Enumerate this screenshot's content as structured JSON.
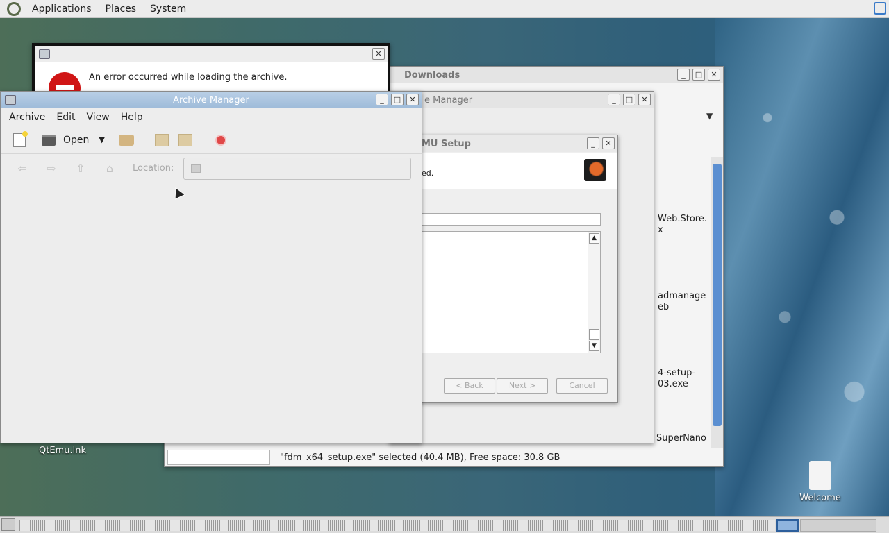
{
  "top_panel": {
    "menus": [
      "Applications",
      "Places",
      "System"
    ]
  },
  "desktop": {
    "icons": [
      {
        "label": "QtEmu.lnk"
      },
      {
        "label": "Welcome"
      }
    ]
  },
  "error_dialog": {
    "message": "An error occurred while loading the archive."
  },
  "downloads_window": {
    "title": "Downloads",
    "files": [
      {
        "line1": "Web.Store.",
        "line2": "x"
      },
      {
        "line1": "admanage",
        "line2": "eb"
      },
      {
        "line1": "4-setup-",
        "line2": "03.exe"
      },
      {
        "line1": "SuperNano",
        "line2": ""
      }
    ],
    "status": "\"fdm_x64_setup.exe\" selected (40.4 MB), Free space: 30.8 GB"
  },
  "archive_manager_back": {
    "title": "e Manager"
  },
  "setup_dialog": {
    "title": "MU Setup",
    "header_text": "ed.",
    "buttons": {
      "back": "< Back",
      "next": "Next >",
      "cancel": "Cancel"
    }
  },
  "archive_manager": {
    "title": "Archive Manager",
    "menu": {
      "archive": "Archive",
      "edit": "Edit",
      "view": "View",
      "help": "Help"
    },
    "toolbar": {
      "open_label": "Open"
    },
    "location_label": "Location:",
    "location_value": ""
  }
}
